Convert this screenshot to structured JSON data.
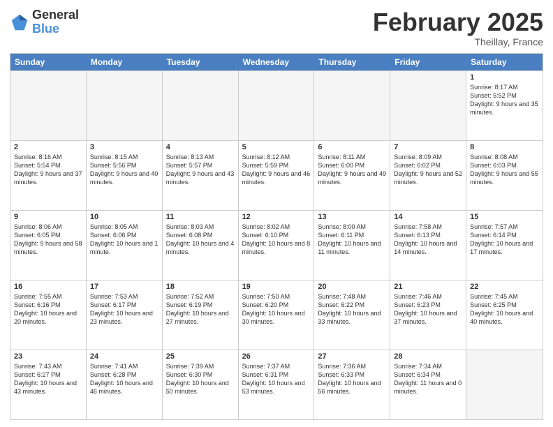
{
  "logo": {
    "general": "General",
    "blue": "Blue"
  },
  "header": {
    "month": "February 2025",
    "location": "Theillay, France"
  },
  "weekdays": [
    "Sunday",
    "Monday",
    "Tuesday",
    "Wednesday",
    "Thursday",
    "Friday",
    "Saturday"
  ],
  "rows": [
    [
      {
        "day": "",
        "empty": true
      },
      {
        "day": "",
        "empty": true
      },
      {
        "day": "",
        "empty": true
      },
      {
        "day": "",
        "empty": true
      },
      {
        "day": "",
        "empty": true
      },
      {
        "day": "",
        "empty": true
      },
      {
        "day": "1",
        "sunrise": "Sunrise: 8:17 AM",
        "sunset": "Sunset: 5:52 PM",
        "daylight": "Daylight: 9 hours and 35 minutes."
      }
    ],
    [
      {
        "day": "2",
        "sunrise": "Sunrise: 8:16 AM",
        "sunset": "Sunset: 5:54 PM",
        "daylight": "Daylight: 9 hours and 37 minutes."
      },
      {
        "day": "3",
        "sunrise": "Sunrise: 8:15 AM",
        "sunset": "Sunset: 5:56 PM",
        "daylight": "Daylight: 9 hours and 40 minutes."
      },
      {
        "day": "4",
        "sunrise": "Sunrise: 8:13 AM",
        "sunset": "Sunset: 5:57 PM",
        "daylight": "Daylight: 9 hours and 43 minutes."
      },
      {
        "day": "5",
        "sunrise": "Sunrise: 8:12 AM",
        "sunset": "Sunset: 5:59 PM",
        "daylight": "Daylight: 9 hours and 46 minutes."
      },
      {
        "day": "6",
        "sunrise": "Sunrise: 8:11 AM",
        "sunset": "Sunset: 6:00 PM",
        "daylight": "Daylight: 9 hours and 49 minutes."
      },
      {
        "day": "7",
        "sunrise": "Sunrise: 8:09 AM",
        "sunset": "Sunset: 6:02 PM",
        "daylight": "Daylight: 9 hours and 52 minutes."
      },
      {
        "day": "8",
        "sunrise": "Sunrise: 8:08 AM",
        "sunset": "Sunset: 6:03 PM",
        "daylight": "Daylight: 9 hours and 55 minutes."
      }
    ],
    [
      {
        "day": "9",
        "sunrise": "Sunrise: 8:06 AM",
        "sunset": "Sunset: 6:05 PM",
        "daylight": "Daylight: 9 hours and 58 minutes."
      },
      {
        "day": "10",
        "sunrise": "Sunrise: 8:05 AM",
        "sunset": "Sunset: 6:06 PM",
        "daylight": "Daylight: 10 hours and 1 minute."
      },
      {
        "day": "11",
        "sunrise": "Sunrise: 8:03 AM",
        "sunset": "Sunset: 6:08 PM",
        "daylight": "Daylight: 10 hours and 4 minutes."
      },
      {
        "day": "12",
        "sunrise": "Sunrise: 8:02 AM",
        "sunset": "Sunset: 6:10 PM",
        "daylight": "Daylight: 10 hours and 8 minutes."
      },
      {
        "day": "13",
        "sunrise": "Sunrise: 8:00 AM",
        "sunset": "Sunset: 6:11 PM",
        "daylight": "Daylight: 10 hours and 11 minutes."
      },
      {
        "day": "14",
        "sunrise": "Sunrise: 7:58 AM",
        "sunset": "Sunset: 6:13 PM",
        "daylight": "Daylight: 10 hours and 14 minutes."
      },
      {
        "day": "15",
        "sunrise": "Sunrise: 7:57 AM",
        "sunset": "Sunset: 6:14 PM",
        "daylight": "Daylight: 10 hours and 17 minutes."
      }
    ],
    [
      {
        "day": "16",
        "sunrise": "Sunrise: 7:55 AM",
        "sunset": "Sunset: 6:16 PM",
        "daylight": "Daylight: 10 hours and 20 minutes."
      },
      {
        "day": "17",
        "sunrise": "Sunrise: 7:53 AM",
        "sunset": "Sunset: 6:17 PM",
        "daylight": "Daylight: 10 hours and 23 minutes."
      },
      {
        "day": "18",
        "sunrise": "Sunrise: 7:52 AM",
        "sunset": "Sunset: 6:19 PM",
        "daylight": "Daylight: 10 hours and 27 minutes."
      },
      {
        "day": "19",
        "sunrise": "Sunrise: 7:50 AM",
        "sunset": "Sunset: 6:20 PM",
        "daylight": "Daylight: 10 hours and 30 minutes."
      },
      {
        "day": "20",
        "sunrise": "Sunrise: 7:48 AM",
        "sunset": "Sunset: 6:22 PM",
        "daylight": "Daylight: 10 hours and 33 minutes."
      },
      {
        "day": "21",
        "sunrise": "Sunrise: 7:46 AM",
        "sunset": "Sunset: 6:23 PM",
        "daylight": "Daylight: 10 hours and 37 minutes."
      },
      {
        "day": "22",
        "sunrise": "Sunrise: 7:45 AM",
        "sunset": "Sunset: 6:25 PM",
        "daylight": "Daylight: 10 hours and 40 minutes."
      }
    ],
    [
      {
        "day": "23",
        "sunrise": "Sunrise: 7:43 AM",
        "sunset": "Sunset: 6:27 PM",
        "daylight": "Daylight: 10 hours and 43 minutes."
      },
      {
        "day": "24",
        "sunrise": "Sunrise: 7:41 AM",
        "sunset": "Sunset: 6:28 PM",
        "daylight": "Daylight: 10 hours and 46 minutes."
      },
      {
        "day": "25",
        "sunrise": "Sunrise: 7:39 AM",
        "sunset": "Sunset: 6:30 PM",
        "daylight": "Daylight: 10 hours and 50 minutes."
      },
      {
        "day": "26",
        "sunrise": "Sunrise: 7:37 AM",
        "sunset": "Sunset: 6:31 PM",
        "daylight": "Daylight: 10 hours and 53 minutes."
      },
      {
        "day": "27",
        "sunrise": "Sunrise: 7:36 AM",
        "sunset": "Sunset: 6:33 PM",
        "daylight": "Daylight: 10 hours and 56 minutes."
      },
      {
        "day": "28",
        "sunrise": "Sunrise: 7:34 AM",
        "sunset": "Sunset: 6:34 PM",
        "daylight": "Daylight: 11 hours and 0 minutes."
      },
      {
        "day": "",
        "empty": true
      }
    ]
  ]
}
